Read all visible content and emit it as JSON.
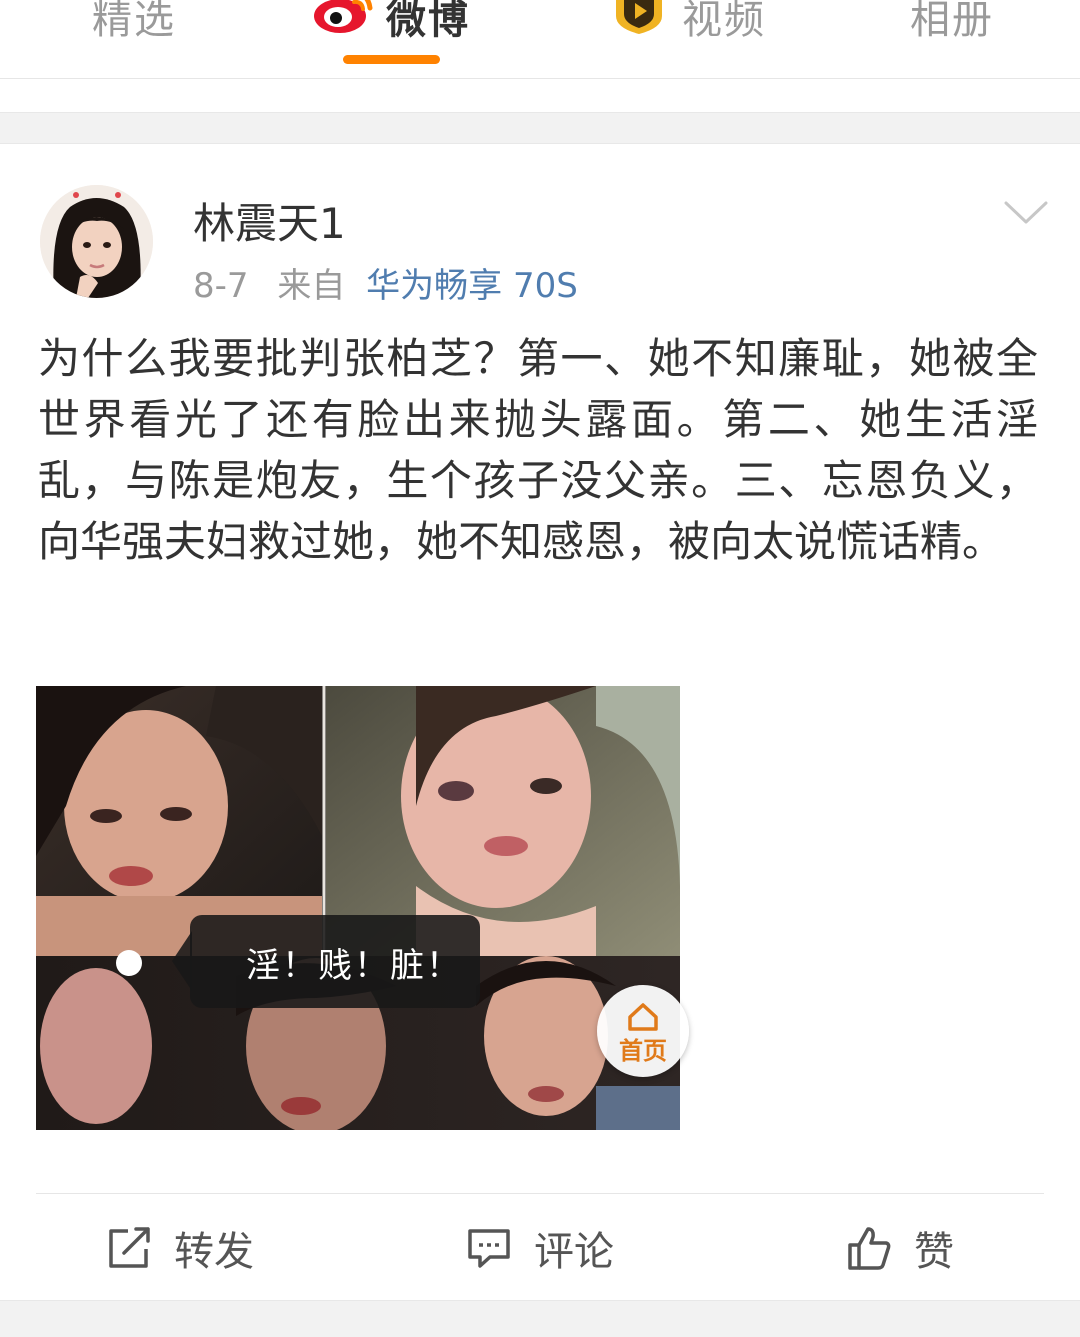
{
  "tabs": [
    {
      "label": "精选",
      "active": false
    },
    {
      "label": "微博",
      "active": true,
      "icon": "weibo-logo-icon"
    },
    {
      "label": "视频",
      "active": false,
      "icon": "video-badge-icon"
    },
    {
      "label": "相册",
      "active": false
    }
  ],
  "colors": {
    "accent": "#ff8200",
    "link": "#507daf",
    "muted": "#9a9a9a",
    "text": "#333333"
  },
  "post": {
    "username": "林震天1",
    "date": "8-7",
    "source_prefix": "来自",
    "source": "华为畅享 70S",
    "text": "为什么我要批判张柏芝？第一、她不知廉耻，她被全世界看光了还有脸出来抛头露面。第二、她生活淫乱，与陈是炮友，生个孩子没父亲。三、忘恩负义，向华强夫妇救过她，她不知感恩，被向太说慌话精。",
    "image": {
      "bubble_text": "淫！贱！脏！",
      "home_badge_label": "首页"
    }
  },
  "actions": {
    "repost": "转发",
    "comment": "评论",
    "like": "赞"
  }
}
